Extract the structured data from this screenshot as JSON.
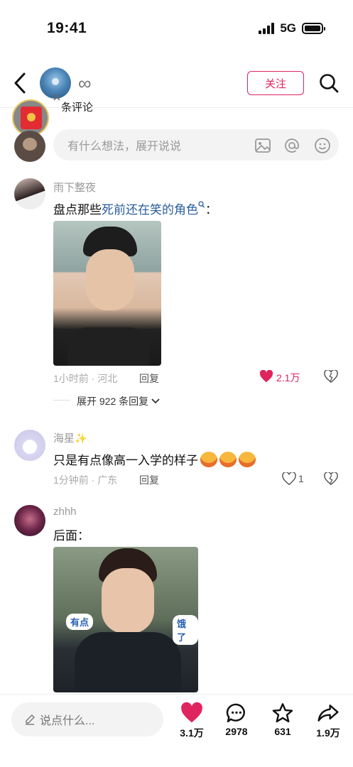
{
  "status": {
    "time": "19:41",
    "network": "5G"
  },
  "header": {
    "name": "∞",
    "follow_label": "关注"
  },
  "comments_section": {
    "count_label": "条评论"
  },
  "comment_input": {
    "placeholder": "有什么想法，展开说说"
  },
  "comments": [
    {
      "user": "雨下整夜",
      "text_prefix": "盘点那些",
      "text_link": "死前还在笑的角色",
      "text_suffix": "：",
      "meta": "1小时前 · 河北",
      "reply_label": "回复",
      "likes": "2.1万",
      "expand_label": "展开 922 条回复"
    },
    {
      "user": "海星",
      "text": "只是有点像高一入学的样子",
      "meta": "1分钟前 · 广东",
      "reply_label": "回复",
      "likes": "1"
    },
    {
      "user": "zhhh",
      "text": "后面：",
      "image_captions": [
        "有点",
        "饿了"
      ]
    }
  ],
  "bottom_bar": {
    "input_placeholder": "说点什么...",
    "likes": "3.1万",
    "comments": "2978",
    "favorites": "631",
    "shares": "1.9万"
  },
  "colors": {
    "accent": "#e0245e",
    "link": "#2a5d9c"
  }
}
